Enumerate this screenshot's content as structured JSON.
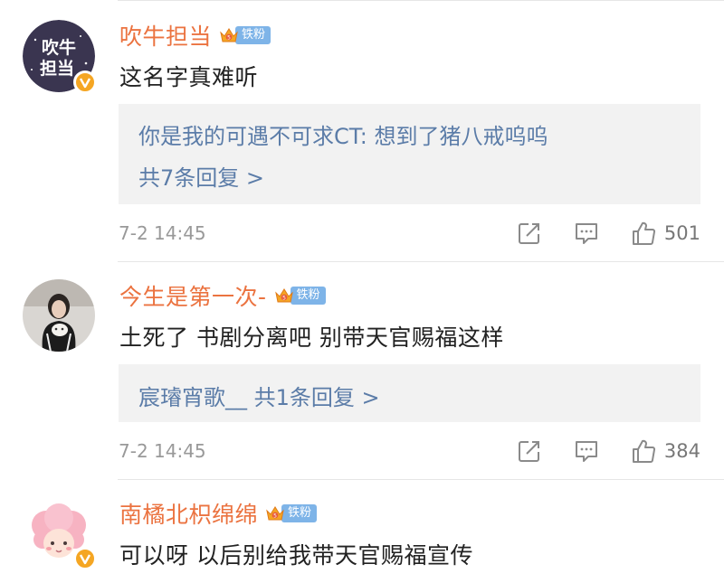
{
  "comments": [
    {
      "username": "吹牛担当",
      "fan_badge": "铁粉",
      "avatar_text": "吹牛担当",
      "content": "这名字真难听",
      "reply_lines": [
        "你是我的可遇不可求CT: 想到了猪八戒呜呜",
        "共7条回复 >"
      ],
      "time": "7-2 14:45",
      "likes": "501"
    },
    {
      "username": "今生是第一次-",
      "fan_badge": "铁粉",
      "content": "土死了 书剧分离吧 别带天官赐福这样",
      "reply_lines": [
        "宸璿宵歌__ 共1条回复 >"
      ],
      "time": "7-2 14:45",
      "likes": "384"
    },
    {
      "username": "南橘北枳绵绵",
      "fan_badge": "铁粉",
      "content": "可以呀 以后别给我带天官赐福宣传"
    }
  ],
  "icons": {
    "share": "share-icon",
    "comment": "comment-icon",
    "like": "thumbs-up-icon",
    "verified": "verified-v-icon",
    "crown": "crown-icon"
  },
  "colors": {
    "username": "#eb7340",
    "reply_link": "#5b7ca8",
    "fan_badge": "#7eb4e8",
    "reply_bg": "#f2f2f2",
    "verified": "#f5a623"
  }
}
